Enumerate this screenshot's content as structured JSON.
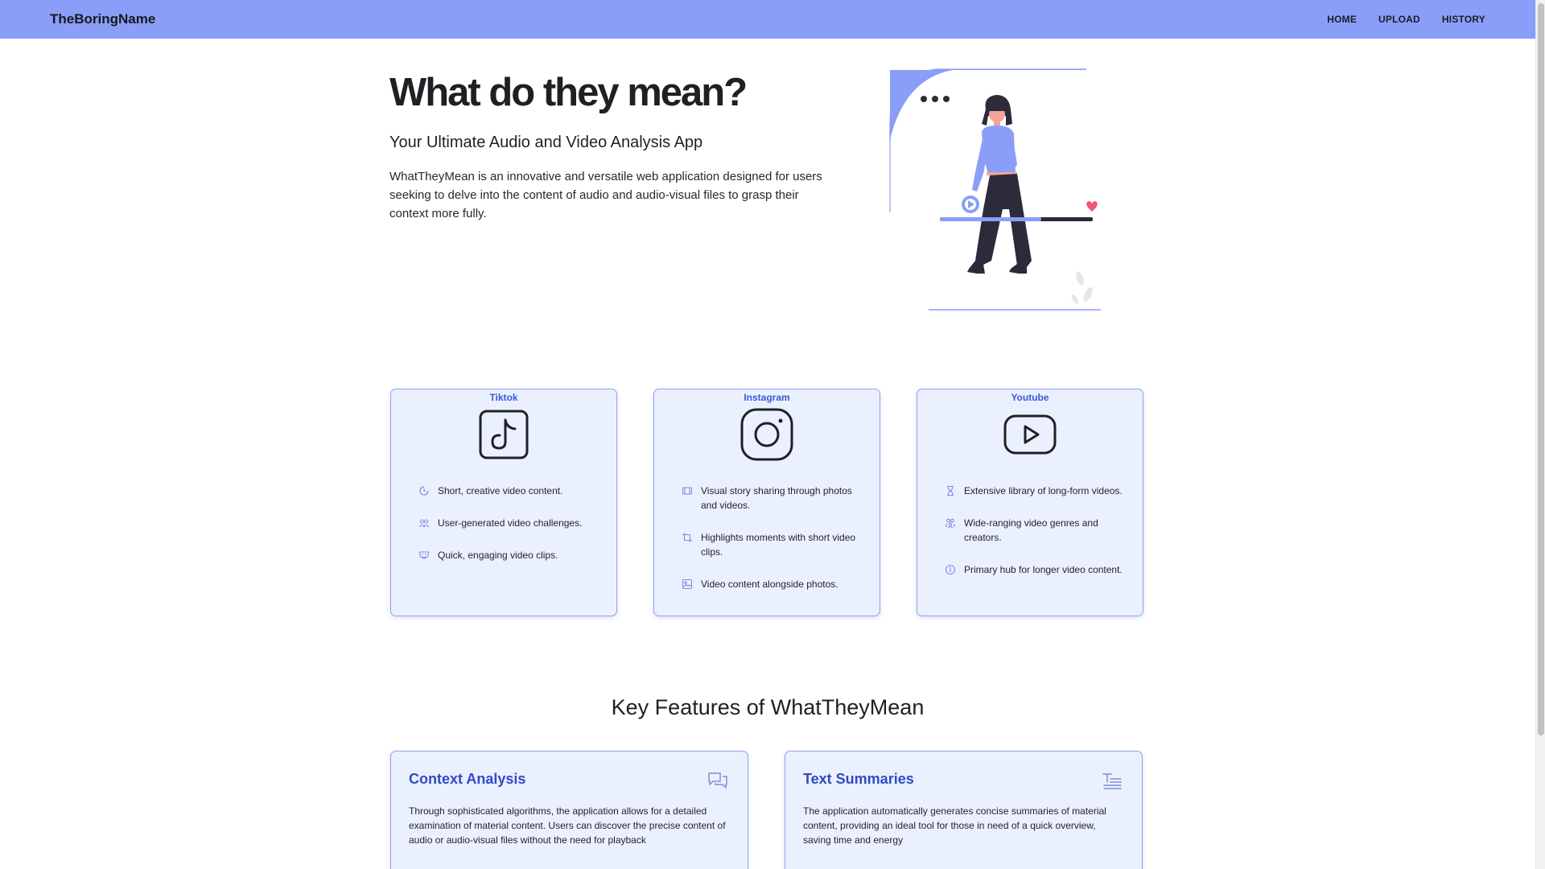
{
  "nav": {
    "brand": "TheBoringName",
    "links": [
      "HOME",
      "UPLOAD",
      "HISTORY"
    ]
  },
  "hero": {
    "title": "What do they mean?",
    "subtitle": "Your Ultimate Audio and Video Analysis App",
    "description": "WhatTheyMean is an innovative and versatile web application designed for users seeking to delve into the content of audio and audio-visual files to grasp their context more fully."
  },
  "platforms": [
    {
      "name": "Tiktok",
      "icon": "tiktok-logo-icon",
      "items": [
        {
          "icon": "clock-icon",
          "text": "Short, creative video content."
        },
        {
          "icon": "users-icon",
          "text": "User-generated video challenges."
        },
        {
          "icon": "mask-icon",
          "text": "Quick, engaging video clips."
        }
      ]
    },
    {
      "name": "Instagram",
      "icon": "instagram-logo-icon",
      "items": [
        {
          "icon": "film-icon",
          "text": "Visual story sharing through photos and videos."
        },
        {
          "icon": "crop-icon",
          "text": "Highlights moments with short video clips."
        },
        {
          "icon": "photo-icon",
          "text": "Video content alongside photos."
        }
      ]
    },
    {
      "name": "Youtube",
      "icon": "youtube-logo-icon",
      "items": [
        {
          "icon": "hourglass-icon",
          "text": "Extensive library of long-form videos."
        },
        {
          "icon": "user-group-icon",
          "text": "Wide-ranging video genres and creators."
        },
        {
          "icon": "info-icon",
          "text": "Primary hub for longer video content."
        }
      ]
    }
  ],
  "features": {
    "title": "Key Features of WhatTheyMean",
    "cards": [
      {
        "title": "Context Analysis",
        "icon": "chat-bubbles-icon",
        "text": "Through sophisticated algorithms, the application allows for a detailed examination of material content. Users can discover the precise content of audio or audio-visual files without the need for playback"
      },
      {
        "title": "Text Summaries",
        "icon": "text-lines-icon",
        "text": "The application automatically generates concise summaries of material content, providing an ideal tool for those in need of a quick overview, saving time and energy"
      }
    ]
  },
  "colors": {
    "navbar": "#8a9ef8",
    "card_bg": "#ebf0fe",
    "card_border": "#8fa2f4",
    "accent": "#3b59d6",
    "illustration_purple": "#8a9ef8",
    "illustration_dark": "#2e2a3a",
    "heart": "#f0567a"
  }
}
